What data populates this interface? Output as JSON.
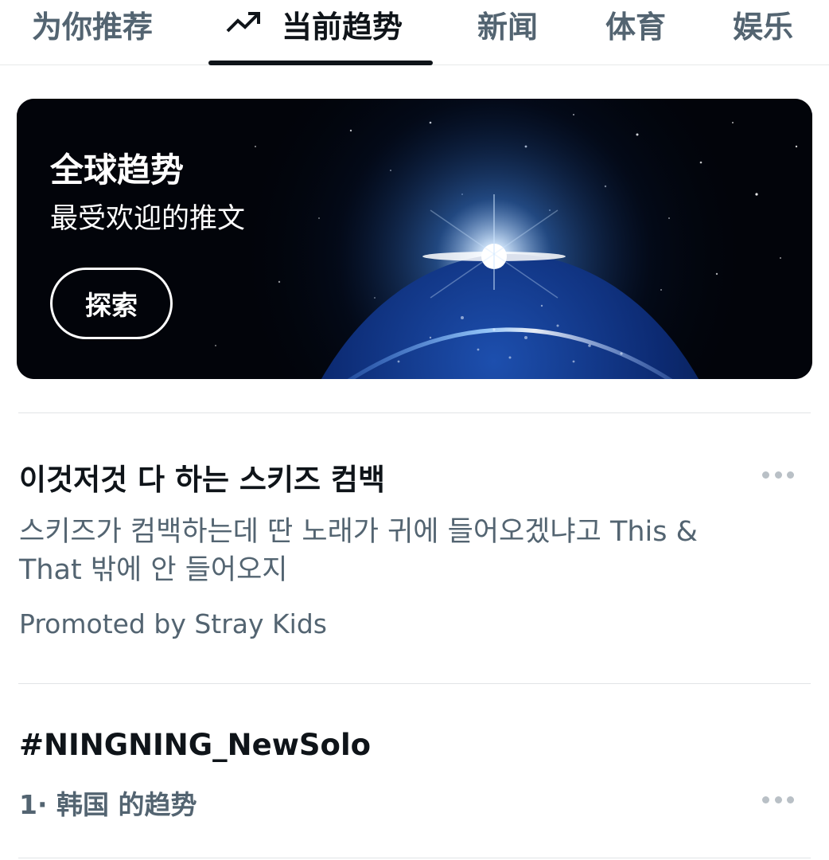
{
  "tabs": [
    {
      "label": "为你推荐",
      "active": false
    },
    {
      "label": "当前趋势",
      "active": true,
      "icon": "trending-up-icon"
    },
    {
      "label": "新闻",
      "active": false
    },
    {
      "label": "体育",
      "active": false
    },
    {
      "label": "娱乐",
      "active": false
    }
  ],
  "hero": {
    "title": "全球趋势",
    "subtitle": "最受欢迎的推文",
    "button_label": "探索",
    "image": "earth-from-space-sunrise"
  },
  "trends": [
    {
      "title": "이것저것 다 하는 스키즈 컴백",
      "description": "스키즈가 컴백하는데 딴 노래가 귀에 들어오겠냐고 This & That 밖에 안 들어오지",
      "meta": "Promoted by Stray Kids"
    },
    {
      "title": "#NINGNING_NewSolo",
      "meta": "1· 韩国 的趋势"
    }
  ],
  "colors": {
    "text_primary": "#0f1419",
    "text_secondary": "#536471",
    "divider": "#e7e9ea"
  }
}
